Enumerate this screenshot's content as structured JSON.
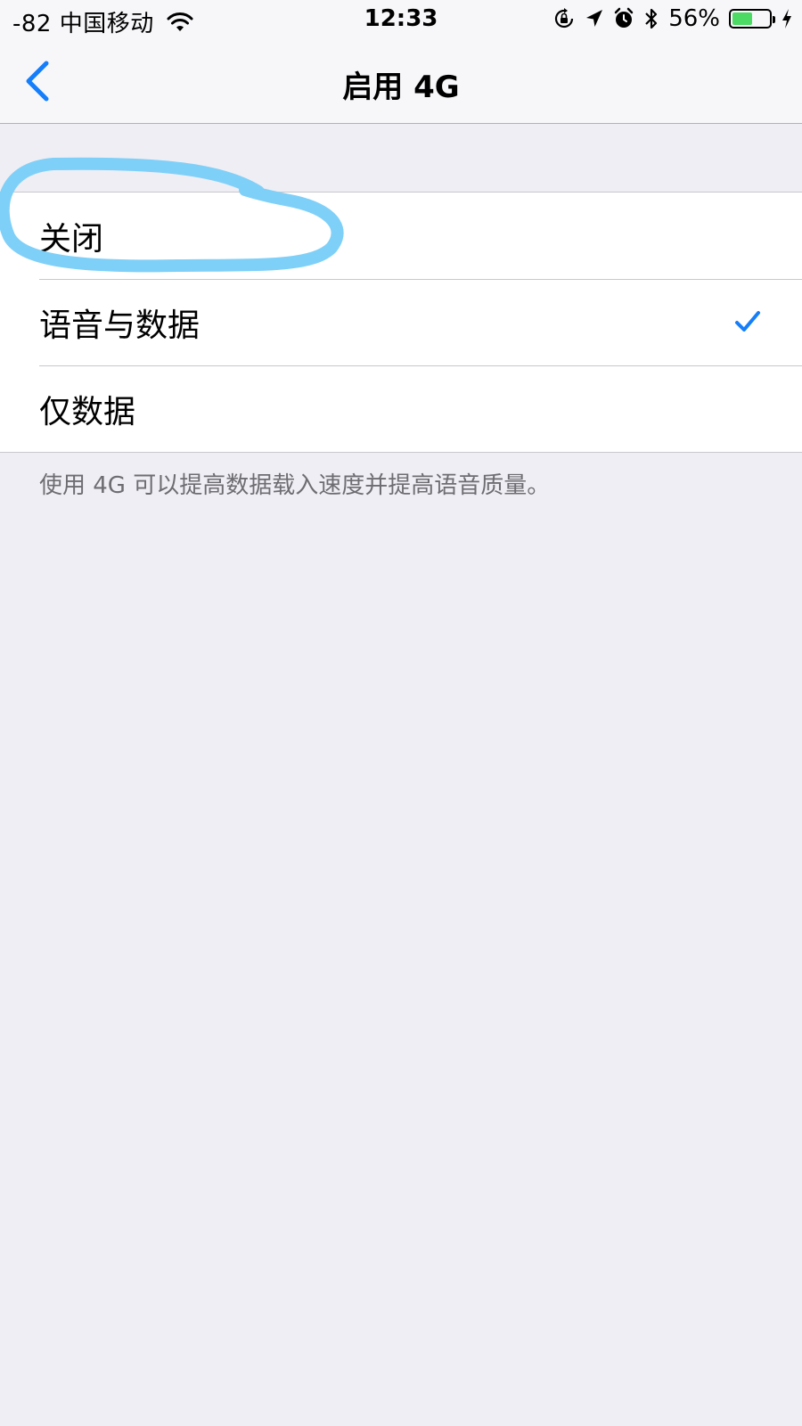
{
  "status_bar": {
    "carrier": "-82 中国移动",
    "time": "12:33",
    "battery_percent": "56%",
    "battery_level": 0.56,
    "icons": [
      "wifi-icon",
      "orientation-lock-icon",
      "location-arrow-icon",
      "alarm-icon",
      "bluetooth-icon",
      "battery-icon",
      "charging-bolt-icon"
    ]
  },
  "nav": {
    "title": "启用 4G",
    "back_icon": "chevron-left-icon"
  },
  "options": [
    {
      "label": "关闭",
      "selected": false
    },
    {
      "label": "语音与数据",
      "selected": true
    },
    {
      "label": "仅数据",
      "selected": false
    }
  ],
  "footer": {
    "note": "使用 4G 可以提高数据载入速度并提高语音质量。"
  },
  "colors": {
    "accent": "#157efb",
    "annotation": "#7fd0f8",
    "background": "#efeef4",
    "battery": "#4cd964"
  }
}
